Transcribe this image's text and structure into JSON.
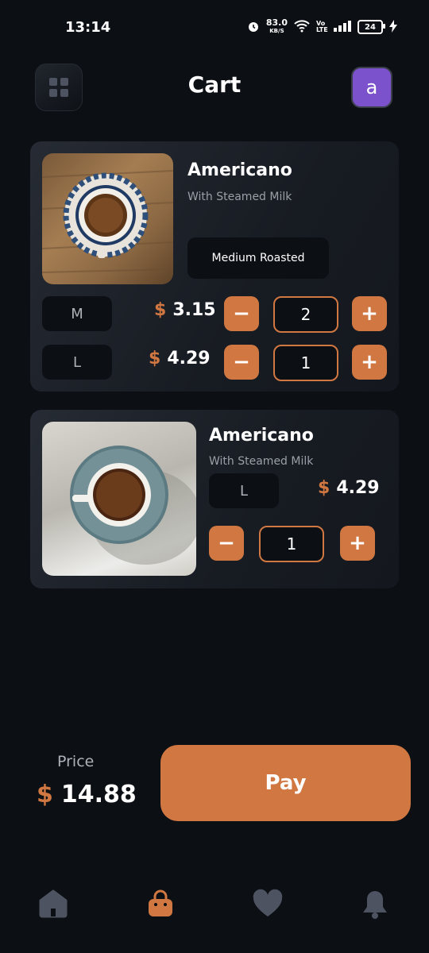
{
  "status_bar": {
    "time": "13:14",
    "net_speed": "83.0",
    "net_unit": "KB/S",
    "volte": "Vo LTE",
    "battery": "24"
  },
  "header": {
    "title": "Cart",
    "avatar_letter": "a"
  },
  "cart": {
    "items": [
      {
        "name": "Americano",
        "subtitle": "With Steamed Milk",
        "roast": "Medium Roasted",
        "sizes": [
          {
            "size": "M",
            "currency": "$",
            "price": "3.15",
            "quantity": "2"
          },
          {
            "size": "L",
            "currency": "$",
            "price": "4.29",
            "quantity": "1"
          }
        ]
      },
      {
        "name": "Americano",
        "subtitle": "With Steamed Milk",
        "sizes": [
          {
            "size": "L",
            "currency": "$",
            "price": "4.29",
            "quantity": "1"
          }
        ]
      }
    ]
  },
  "footer": {
    "price_label": "Price",
    "currency": "$",
    "total": "14.88",
    "pay_label": "Pay"
  },
  "buttons": {
    "minus": "−",
    "plus": "+"
  },
  "nav": {
    "items": [
      "home-icon",
      "bag-icon",
      "heart-icon",
      "bell-icon"
    ],
    "active": "bag-icon"
  },
  "colors": {
    "accent": "#D17842",
    "background": "#0C0F14",
    "card": "#1E222A",
    "avatar": "#7B52CC",
    "inactive_icon": "#4E5361"
  }
}
